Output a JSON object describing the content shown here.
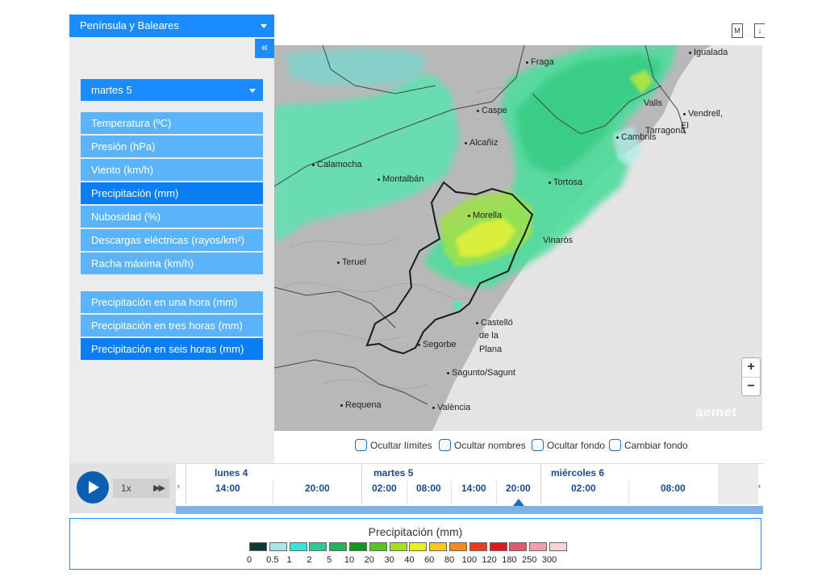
{
  "region": "Península y Baleares",
  "collapse_label": "«",
  "day": "martes 5",
  "variables": [
    {
      "label": "Temperatura (ºC)",
      "active": false
    },
    {
      "label": "Presión (hPa)",
      "active": false
    },
    {
      "label": "Viento (km/h)",
      "active": false
    },
    {
      "label": "Precipitación (mm)",
      "active": true
    },
    {
      "label": "Nubosidad (%)",
      "active": false
    },
    {
      "label": "Descargas eléctricas (rayos/km²)",
      "active": false
    },
    {
      "label": "Racha máxima (km/h)",
      "active": false
    }
  ],
  "hour_variables": [
    {
      "label": "Precipitación en una hora (mm)",
      "active": false
    },
    {
      "label": "Precipitación en tres horas (mm)",
      "active": false
    },
    {
      "label": "Precipitación en seis horas (mm)",
      "active": true
    }
  ],
  "top_icons": {
    "m_label": "M",
    "download_label": "↓"
  },
  "map": {
    "cities": [
      "Fraga",
      "Igualada",
      "Caspe",
      "Valls",
      "Vendrell,",
      "El",
      "Tarragona",
      "Cambrils",
      "Alcañiz",
      "Calamocha",
      "Montalbán",
      "Tortosa",
      "Morella",
      "Vinaròs",
      "Teruel",
      "Castelló",
      "de la",
      "Plana",
      "Segorbe",
      "Sagunto/Sagunt",
      "Requena",
      "València"
    ],
    "zoom_in": "+",
    "zoom_out": "−",
    "watermark": "aemet"
  },
  "options": [
    "Ocultar límites",
    "Ocultar nombres",
    "Ocultar fondo",
    "Cambiar fondo"
  ],
  "player": {
    "speed": "1x",
    "ff": "▶▶"
  },
  "timeline": {
    "prev": "‹",
    "next": "›",
    "days": [
      "lunes 4",
      "martes 5",
      "miércoles 6"
    ],
    "hours": [
      "14:00",
      "20:00",
      "02:00",
      "08:00",
      "14:00",
      "20:00",
      "02:00",
      "08:00"
    ],
    "selected_hour_index": 5
  },
  "legend": {
    "title": "Precipitación (mm)",
    "values": [
      "0",
      "0.5",
      "1",
      "2",
      "5",
      "10",
      "20",
      "30",
      "40",
      "60",
      "80",
      "100",
      "120",
      "180",
      "250",
      "300"
    ],
    "colors": [
      "#0c3a3a",
      "#a8e6e6",
      "#33e6d9",
      "#2fc996",
      "#22b45a",
      "#0f9a1e",
      "#52c81a",
      "#a5e01a",
      "#e8f01a",
      "#f5c81a",
      "#f58a1a",
      "#f03c1a",
      "#e01a1a",
      "#e05a6a",
      "#f0a0a8",
      "#fbd2d6"
    ]
  }
}
